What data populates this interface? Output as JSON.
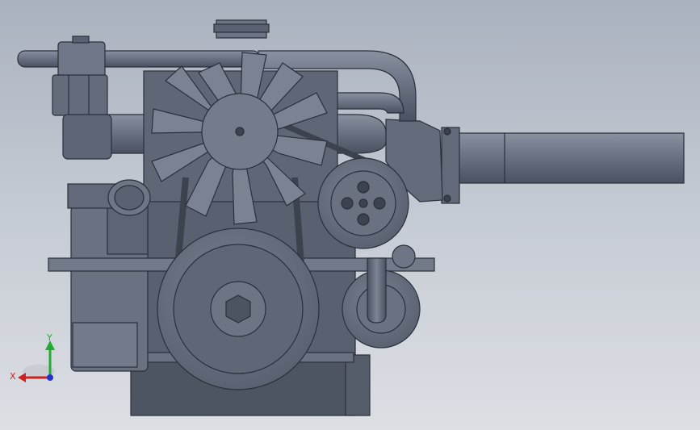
{
  "viewport": {
    "background_top": "#aab2bf",
    "background_bottom": "#dcdfe4",
    "model_color": "#6b7384",
    "edge_color": "#2a2f3a"
  },
  "triad": {
    "x_label": "X",
    "y_label": "Y",
    "x_color": "#cc2222",
    "y_color": "#22aa33",
    "z_color": "#2233cc"
  }
}
